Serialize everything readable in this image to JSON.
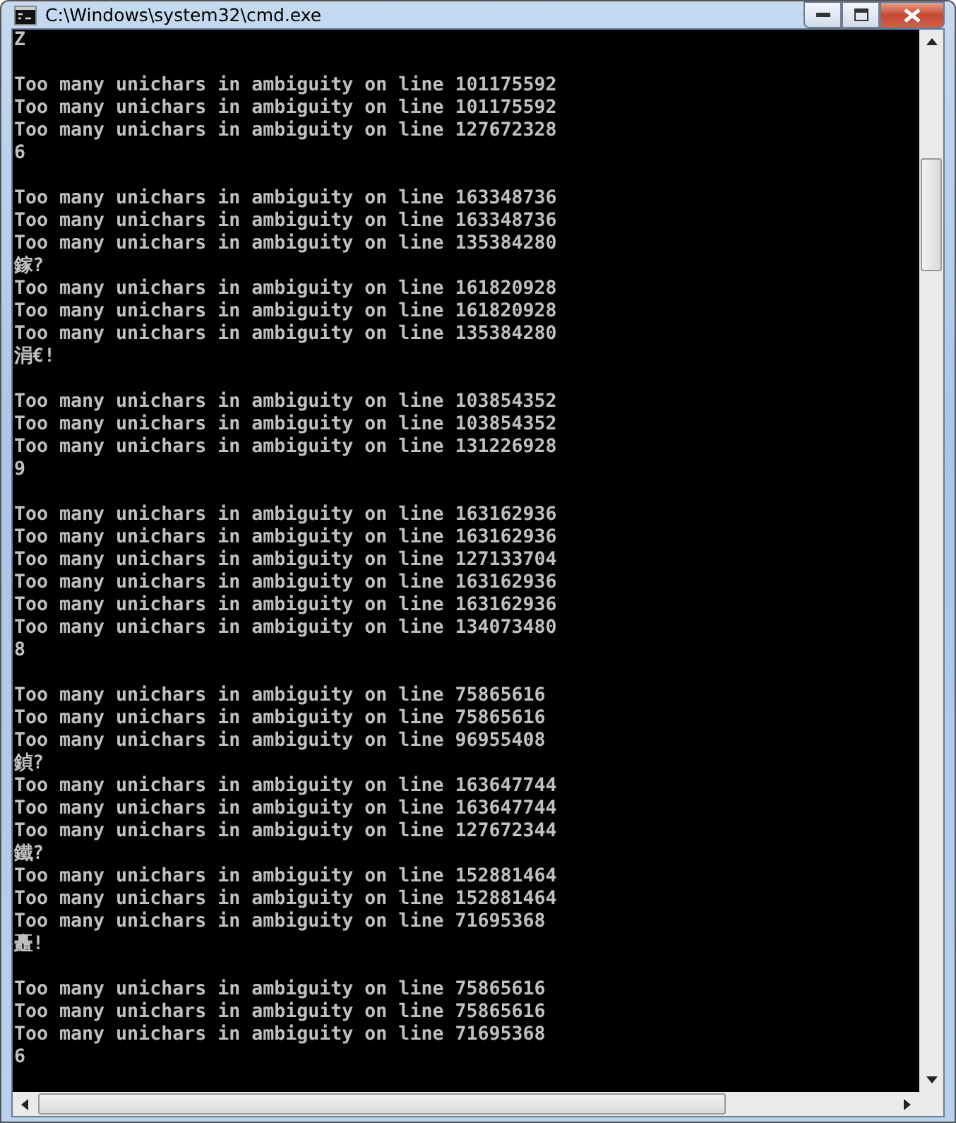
{
  "window": {
    "title": "C:\\Windows\\system32\\cmd.exe"
  },
  "console": {
    "blocks": [
      {
        "lines": [
          "Z"
        ]
      },
      {
        "lines": [
          "Too many unichars in ambiguity on line 101175592",
          "Too many unichars in ambiguity on line 101175592",
          "Too many unichars in ambiguity on line 127672328",
          "6"
        ]
      },
      {
        "lines": [
          "Too many unichars in ambiguity on line 163348736",
          "Too many unichars in ambiguity on line 163348736",
          "Too many unichars in ambiguity on line 135384280",
          "鎵?",
          "Too many unichars in ambiguity on line 161820928",
          "Too many unichars in ambiguity on line 161820928",
          "Too many unichars in ambiguity on line 135384280",
          "涓€!"
        ]
      },
      {
        "lines": [
          "Too many unichars in ambiguity on line 103854352",
          "Too many unichars in ambiguity on line 103854352",
          "Too many unichars in ambiguity on line 131226928",
          "9"
        ]
      },
      {
        "lines": [
          "Too many unichars in ambiguity on line 163162936",
          "Too many unichars in ambiguity on line 163162936",
          "Too many unichars in ambiguity on line 127133704",
          "Too many unichars in ambiguity on line 163162936",
          "Too many unichars in ambiguity on line 163162936",
          "Too many unichars in ambiguity on line 134073480",
          "8"
        ]
      },
      {
        "lines": [
          "Too many unichars in ambiguity on line 75865616",
          "Too many unichars in ambiguity on line 75865616",
          "Too many unichars in ambiguity on line 96955408",
          "鍞?",
          "Too many unichars in ambiguity on line 163647744",
          "Too many unichars in ambiguity on line 163647744",
          "Too many unichars in ambiguity on line 127672344",
          "鐵?",
          "Too many unichars in ambiguity on line 152881464",
          "Too many unichars in ambiguity on line 152881464",
          "Too many unichars in ambiguity on line 71695368",
          "矗!"
        ]
      },
      {
        "lines": [
          "Too many unichars in ambiguity on line 75865616",
          "Too many unichars in ambiguity on line 75865616",
          "Too many unichars in ambiguity on line 71695368",
          "6"
        ]
      }
    ]
  }
}
